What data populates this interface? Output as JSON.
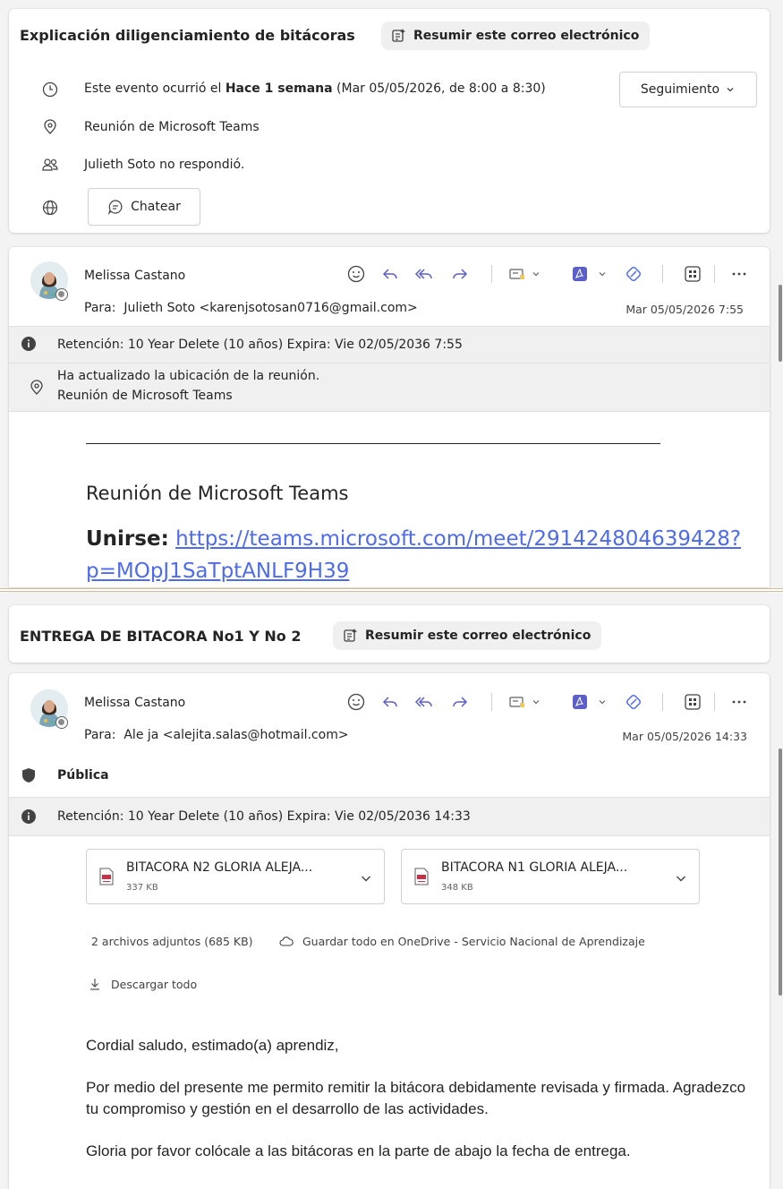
{
  "email1": {
    "subject": "Explicación diligenciamiento de bitácoras",
    "summarize_label": "Resumir este correo electrónico",
    "event": {
      "prefix": "Este evento ocurrió el ",
      "bold": "Hace 1 semana",
      "suffix": " (Mar 05/05/2026, de 8:00 a 8:30)",
      "follow_up": "Seguimiento"
    },
    "location": "Reunión de Microsoft Teams",
    "attendee_name": "Julieth Soto",
    "attendee_status": " no respondió.",
    "chat_label": "Chatear",
    "message": {
      "sender": "Melissa Castano",
      "to_label": "Para:",
      "to": "Julieth Soto <karenjsotosan0716@gmail.com>",
      "date": "Mar 05/05/2026 7:55",
      "retention": "Retención: 10 Year Delete (10 años) Expira: Vie 02/05/2036 7:55",
      "location_update_line1": "Ha actualizado la ubicación de la reunión.",
      "location_update_line2": "Reunión de Microsoft Teams",
      "divider": "________________________________________________________________________________",
      "teams_heading": "Reunión de Microsoft Teams",
      "join_label": "Unirse:",
      "join_link_line1": "https://teams.microsoft.com/meet/291424804639428?",
      "join_link_line2": "p=MOpJ1SaTptANLF9H39"
    }
  },
  "email2": {
    "subject": "ENTREGA DE BITACORA No1 Y No 2",
    "summarize_label": "Resumir este correo electrónico",
    "message": {
      "sender": "Melissa Castano",
      "to_label": "Para:",
      "to": "Ale ja <alejita.salas@hotmail.com>",
      "date": "Mar 05/05/2026 14:33",
      "sensitivity": "Pública",
      "retention": "Retención: 10 Year Delete (10 años) Expira: Vie 02/05/2036 14:33",
      "attachments": [
        {
          "name": "BITACORA N2 GLORIA ALEJA...",
          "size": "337 KB"
        },
        {
          "name": "BITACORA N1 GLORIA ALEJA...",
          "size": "348 KB"
        }
      ],
      "attachments_summary": "2 archivos adjuntos (685 KB)",
      "save_onedrive": "Guardar todo en OneDrive - Servicio Nacional de Aprendizaje",
      "download_all": "Descargar todo",
      "greeting": "Cordial saludo, estimado(a) aprendiz,",
      "paragraph1": "Por medio del presente me permito remitir la bitácora debidamente revisada y firmada. Agradezco tu compromiso y gestión en el desarrollo de las actividades.",
      "paragraph2": "Gloria por favor colócale a las bitácoras en la parte de abajo la fecha de entrega."
    }
  },
  "colors": {
    "accent_purple": "#5b5fc7",
    "link_blue": "#4f6bed",
    "pdf_red": "#c4314b"
  }
}
